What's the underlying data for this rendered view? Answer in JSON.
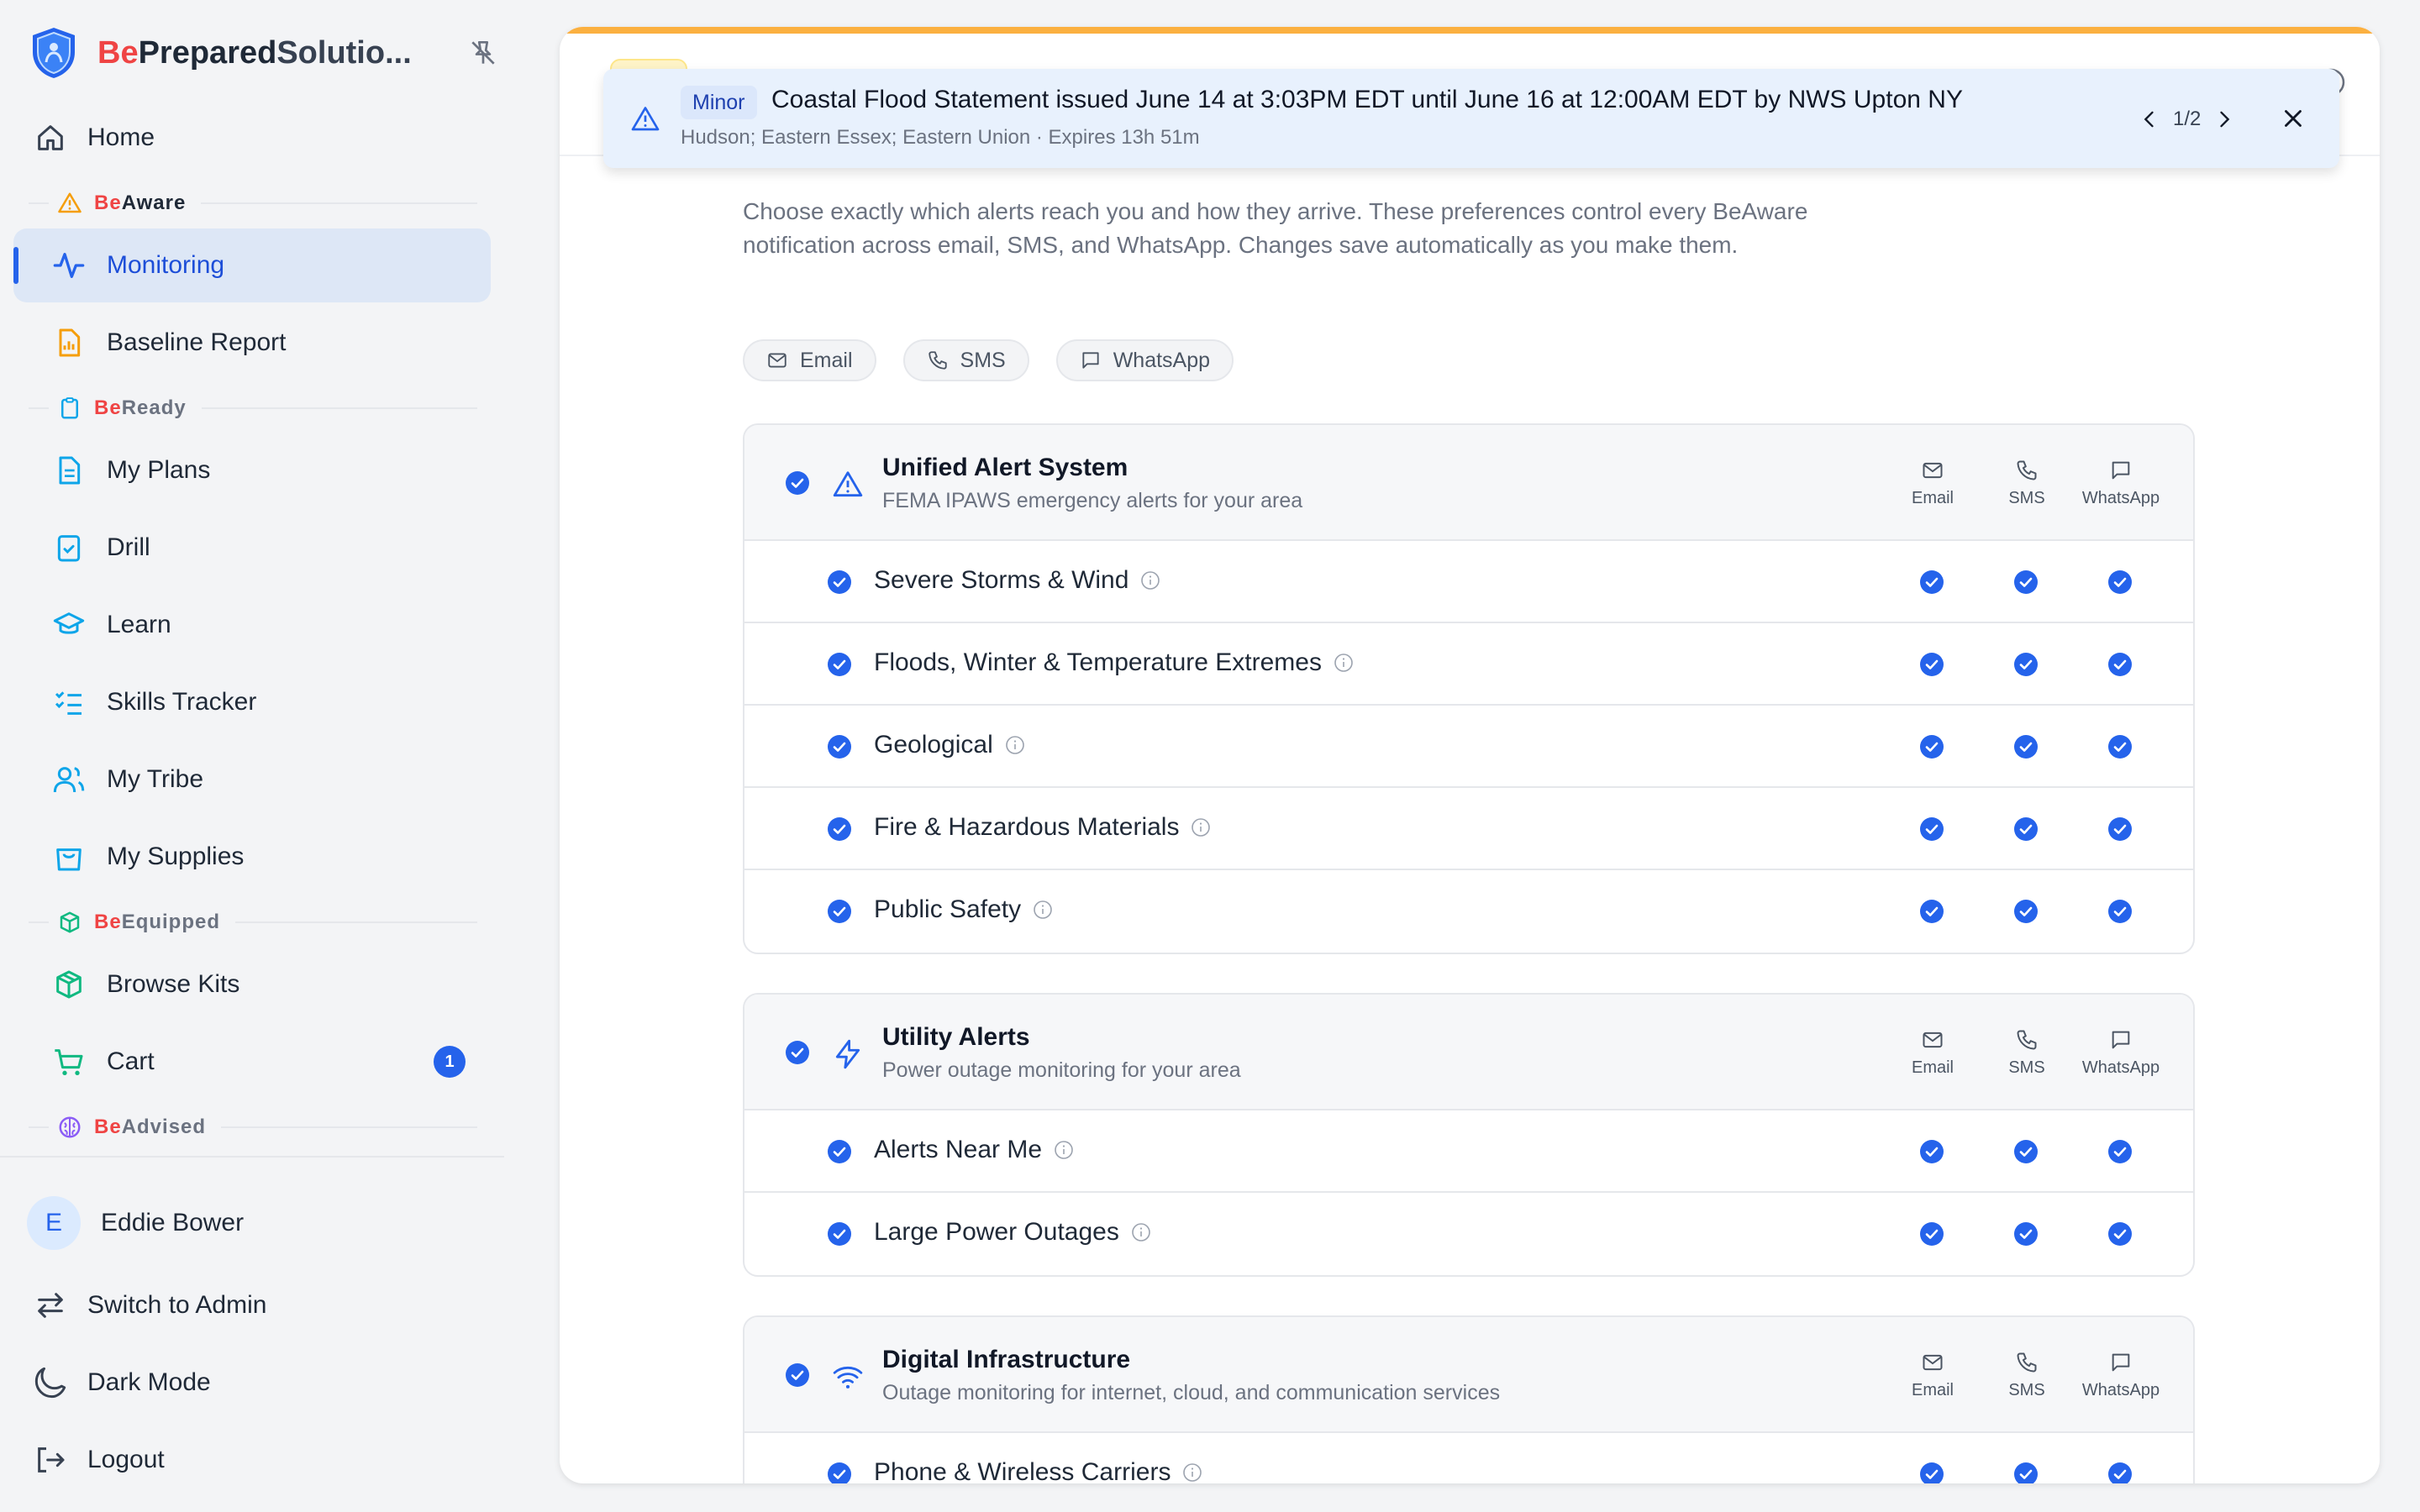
{
  "brand": {
    "be": "Be",
    "prepared": "Prepared",
    "rest": "Solutio..."
  },
  "nav": {
    "home": "Home",
    "sections": {
      "beaware": {
        "be": "Be",
        "rest": "Aware"
      },
      "beready": {
        "be": "Be",
        "rest": "Ready"
      },
      "beequipped": {
        "be": "Be",
        "rest": "Equipped"
      },
      "beadvised": {
        "be": "Be",
        "rest": "Advised"
      }
    },
    "items": {
      "monitoring": "Monitoring",
      "baseline_report": "Baseline Report",
      "my_plans": "My Plans",
      "drill": "Drill",
      "learn": "Learn",
      "skills_tracker": "Skills Tracker",
      "my_tribe": "My Tribe",
      "my_supplies": "My Supplies",
      "browse_kits": "Browse Kits",
      "cart": "Cart"
    },
    "cart_badge": "1"
  },
  "user": {
    "initial": "E",
    "name": "Eddie Bower"
  },
  "footer": {
    "switch_admin": "Switch to Admin",
    "dark_mode": "Dark Mode",
    "logout": "Logout"
  },
  "banner": {
    "severity": "Minor",
    "title": "Coastal Flood Statement issued June 14 at 3:03PM EDT until June 16 at 12:00AM EDT by NWS Upton NY",
    "subtitle": "Hudson; Eastern Essex; Eastern Union · Expires 13h 51m",
    "pager": "1/2"
  },
  "intro": "Choose exactly which alerts reach you and how they arrive. These preferences control every BeAware notification across email, SMS, and WhatsApp. Changes save automatically as you make them.",
  "chips": {
    "email": "Email",
    "sms": "SMS",
    "whatsapp": "WhatsApp"
  },
  "channels": {
    "email": "Email",
    "sms": "SMS",
    "whatsapp": "WhatsApp"
  },
  "groups": [
    {
      "title": "Unified Alert System",
      "subtitle": "FEMA IPAWS emergency alerts for your area",
      "rows": [
        "Severe Storms & Wind",
        "Floods, Winter & Temperature Extremes",
        "Geological",
        "Fire & Hazardous Materials",
        "Public Safety"
      ]
    },
    {
      "title": "Utility Alerts",
      "subtitle": "Power outage monitoring for your area",
      "rows": [
        "Alerts Near Me",
        "Large Power Outages"
      ]
    },
    {
      "title": "Digital Infrastructure",
      "subtitle": "Outage monitoring for internet, cloud, and communication services",
      "rows": [
        "Phone & Wireless Carriers"
      ]
    }
  ],
  "colors": {
    "accent": "#2563eb",
    "brand_red": "#ef4444",
    "warning_bar": "#fbb040",
    "banner_bg": "#e8f1fd"
  }
}
